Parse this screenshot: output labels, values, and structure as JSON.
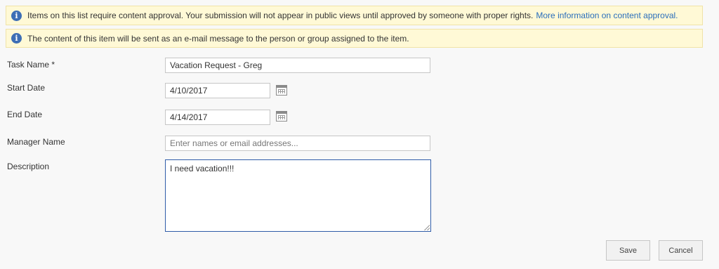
{
  "notices": {
    "approval": {
      "text": "Items on this list require content approval. Your submission will not appear in public views until approved by someone with proper rights.",
      "link": "More information on content approval."
    },
    "email": {
      "text": "The content of this item will be sent as an e-mail message to the person or group assigned to the item."
    },
    "icon": "info-icon"
  },
  "form": {
    "task_name": {
      "label": "Task Name *",
      "value": "Vacation Request - Greg"
    },
    "start_date": {
      "label": "Start Date",
      "value": "4/10/2017"
    },
    "end_date": {
      "label": "End Date",
      "value": "4/14/2017"
    },
    "manager_name": {
      "label": "Manager Name",
      "placeholder": "Enter names or email addresses..."
    },
    "description": {
      "label": "Description",
      "value": "I need vacation!!!"
    }
  },
  "buttons": {
    "save": "Save",
    "cancel": "Cancel"
  },
  "colors": {
    "notice_bg": "#fff9d6",
    "info_icon": "#3d6eb5",
    "link": "#2a6ebb",
    "focus_border": "#2f5ca8"
  }
}
